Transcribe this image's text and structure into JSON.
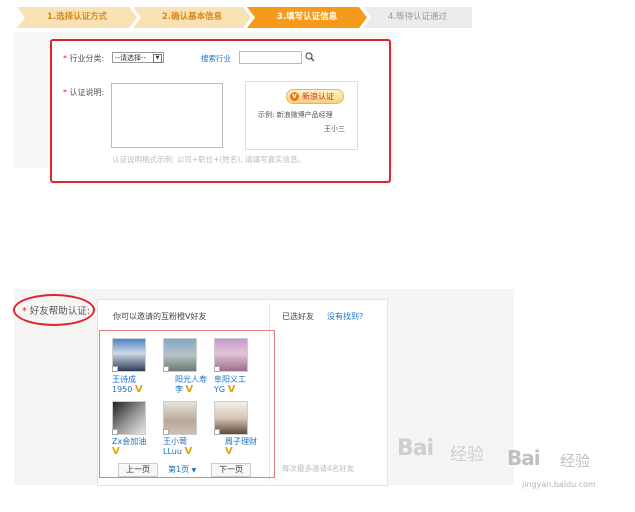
{
  "steps": [
    "1.选择认证方式",
    "2.确认基本信息",
    "3.填写认证信息",
    "4.等待认证通过"
  ],
  "form": {
    "star": "*",
    "industry_label": "行业分类:",
    "industry_select": "--请选择--",
    "search_industry_link": "搜索行业",
    "desc_label": "认证说明:",
    "sample_badge": "新浪认证",
    "sample_badge_icon": "V",
    "sample_text_1": "示例: 新浪微博产品经理",
    "sample_text_2": "王小三",
    "hint": "认证说明格式示例: 公司+职位+(姓名), 请填写真实信息。"
  },
  "friends": {
    "label": "好友帮助认证:",
    "star": "*",
    "invite_title": "你可以邀请的互粉橙V好友",
    "selected_title": "已选好友",
    "not_found_link": "没有找到?",
    "max_hint": "每次最多邀请4名好友",
    "v_mark": "V",
    "list": [
      {
        "name_1": "王诗成",
        "name_2": "1950"
      },
      {
        "name_1": "阳光人寿",
        "name_2": "李"
      },
      {
        "name_1": "阜阳义工",
        "name_2": "YG"
      },
      {
        "name_1": "Zx会加油",
        "name_2": ""
      },
      {
        "name_1": "王小莺",
        "name_2": "LLuu"
      },
      {
        "name_1": "周子理财",
        "name_2": ""
      }
    ],
    "pager": {
      "prev": "上一页",
      "current": "第1页",
      "next": "下一页"
    }
  },
  "watermark": {
    "text_main": "Bai",
    "text_cn": "经验",
    "url": "jingyan.baidu.com"
  },
  "colors": {
    "accent_orange": "#f59a1b",
    "red": "#e0242c",
    "link": "#1a6fc4"
  }
}
